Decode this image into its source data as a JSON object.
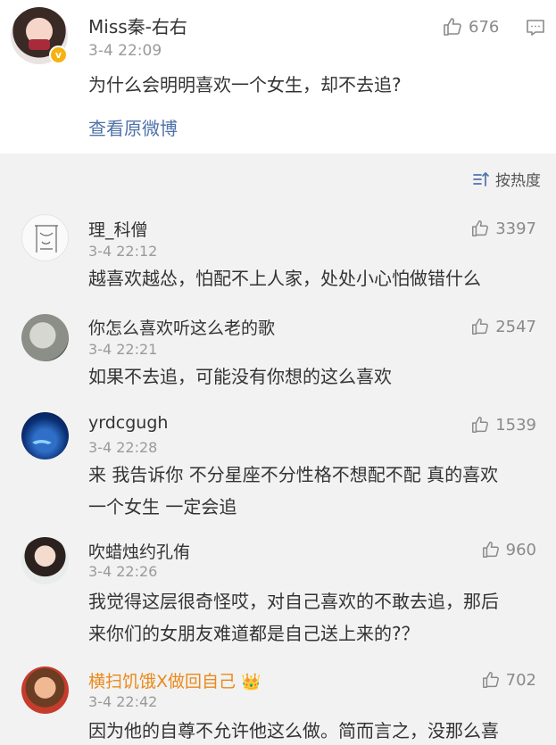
{
  "post": {
    "author": "Miss秦-右右",
    "time": "3-4 22:09",
    "text": "为什么会明明喜欢一个女生，却不去追?",
    "view_original": "查看原微博",
    "likes": "676",
    "verified_badge": "v"
  },
  "sort": {
    "label": "按热度"
  },
  "comments": [
    {
      "name": "理_科僧",
      "time": "3-4 22:12",
      "likes": "3397",
      "text": "越喜欢越怂，怕配不上人家，处处小心怕做错什么"
    },
    {
      "name": "你怎么喜欢听这么老的歌",
      "time": "3-4 22:21",
      "likes": "2547",
      "text": "如果不去追，可能没有你想的这么喜欢"
    },
    {
      "name": "yrdcgugh",
      "time": "3-4 22:28",
      "likes": "1539",
      "text_line1": "来 我告诉你 不分星座不分性格不想配不配 真的喜欢",
      "text_line2": "一个女生 一定会追"
    },
    {
      "name": "吹蜡烛约孔侑",
      "time": "3-4 22:26",
      "likes": "960",
      "text_line1": "我觉得这层很奇怪哎，对自己喜欢的不敢去追，那后",
      "text_line2": "来你们的女朋友难道都是自己送上来的?？"
    },
    {
      "name": "横扫饥饿X做回自己",
      "time": "3-4 22:42",
      "likes": "702",
      "text": "因为他的自尊不允许他这么做。简而言之，没那么喜"
    }
  ],
  "colors": {
    "link": "#4f72a8",
    "gold_name": "#e98a1b",
    "list_bg": "#f2f2f2"
  },
  "icons": [
    "thumb-up-icon",
    "comment-icon",
    "sort-icon",
    "verified-badge-icon",
    "crown-emoji-icon"
  ]
}
